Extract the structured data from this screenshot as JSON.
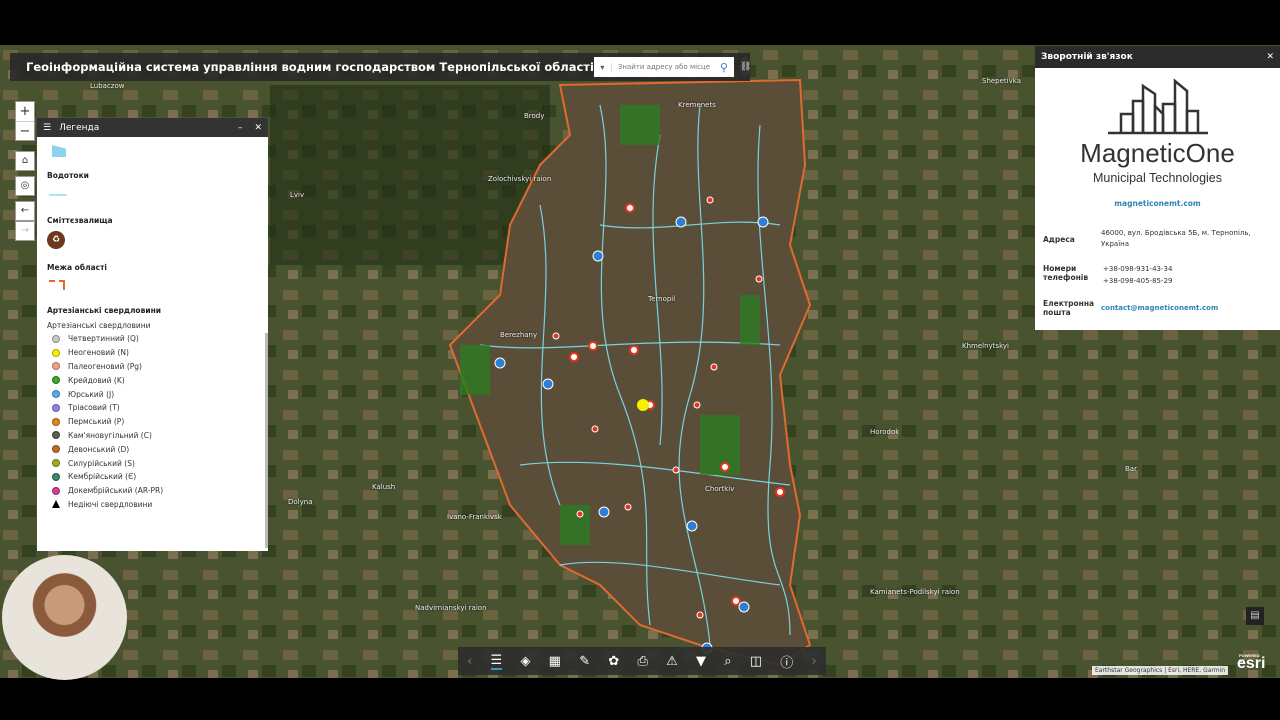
{
  "header": {
    "title": "Геоінформаційна система управління водним господарством Тернопільської області",
    "search_placeholder": "Знайти адресу або місце"
  },
  "map_labels": [
    "Lubaczow",
    "Brody",
    "Kremenets",
    "Lviv",
    "Zolochivskyi raion",
    "Ternopil",
    "Khmelnytskyi",
    "Horodok",
    "Chortkiv",
    "Kalush",
    "Dolyna",
    "Ivano-Frankivsk",
    "Nadvirnianskyi raion",
    "Shepetivka",
    "Kamianets-Podilskyi raion",
    "Bar",
    "Berezhany"
  ],
  "legend": {
    "title": "Легенда",
    "sections": {
      "vodotoky": "Водотоки",
      "smittia": "Сміттєзвалища",
      "mezha": "Межа області",
      "artesian": "Артезіанські свердловини"
    },
    "sublabel": "Артезіанські свердловини",
    "items": [
      {
        "label": "Четвертинний (Q)",
        "color": "#c8c8c8"
      },
      {
        "label": "Неогеновий (N)",
        "color": "#f5f000"
      },
      {
        "label": "Палеогеновий (Pg)",
        "color": "#f2a07c"
      },
      {
        "label": "Крейдовий (K)",
        "color": "#3aa52a"
      },
      {
        "label": "Юрський (J)",
        "color": "#5ea8e8"
      },
      {
        "label": "Тріасовий (T)",
        "color": "#9a82e0"
      },
      {
        "label": "Пермський (P)",
        "color": "#e0841c"
      },
      {
        "label": "Кам'яновугільний (C)",
        "color": "#5a6058"
      },
      {
        "label": "Девонський (D)",
        "color": "#c06a2a"
      },
      {
        "label": "Силурійський (S)",
        "color": "#a0a820"
      },
      {
        "label": "Кембрійський (Є)",
        "color": "#3a8a70"
      },
      {
        "label": "Докембрійський (AR-PR)",
        "color": "#d0409a"
      },
      {
        "label": "Недіючі свердловини",
        "color": "#000000"
      }
    ]
  },
  "contact": {
    "title": "Зворотній зв'язок",
    "brand": "MagneticOne",
    "tagline": "Municipal Technologies",
    "site": "magneticonemt.com",
    "address_label": "Адреса",
    "address": "46000, вул. Бродівська 5Б, м. Тернопіль, Україна",
    "phones_label": "Номери телефонів",
    "phone1": "+38-098-931-43-34",
    "phone2": "+38-098-405-85-29",
    "email_label": "Електронна пошта",
    "email": "contact@magneticonemt.com"
  },
  "attribution": "Earthstar Geographics | Esri, HERE, Garmin",
  "esri": {
    "powered": "POWERED BY",
    "name": "esri"
  }
}
